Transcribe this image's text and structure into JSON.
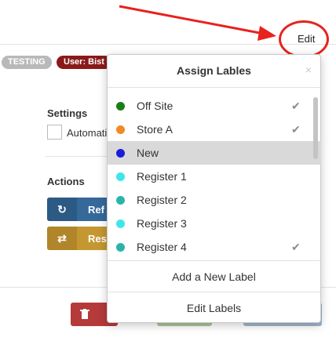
{
  "background": {
    "tags": {
      "testing": "TESTING",
      "user": "User: Bist"
    },
    "settings": {
      "heading": "Settings",
      "checkbox_label": "Automati"
    },
    "actions": {
      "heading": "Actions",
      "buttons": [
        {
          "label": "Ref",
          "icon": "refresh-icon",
          "color": "#34699a"
        },
        {
          "label": "Res",
          "icon": "retweet-icon",
          "color": "#c59730"
        }
      ]
    }
  },
  "annotation": {
    "edit_link": "Edit",
    "circle_color": "#e8221c"
  },
  "popover": {
    "title": "Assign Lables",
    "close_glyph": "×",
    "labels": [
      {
        "name": "Off Site",
        "color": "#1a7d1a",
        "checked": true
      },
      {
        "name": "Store A",
        "color": "#f08a24",
        "checked": true
      },
      {
        "name": "New",
        "color": "#1b1bd9",
        "checked": false,
        "selected": true
      },
      {
        "name": "Register 1",
        "color": "#3fe6e8",
        "checked": false
      },
      {
        "name": "Register 2",
        "color": "#29b3ad",
        "checked": false
      },
      {
        "name": "Register 3",
        "color": "#3fe6e8",
        "checked": false
      },
      {
        "name": "Register 4",
        "color": "#29b3ad",
        "checked": true
      }
    ],
    "add_label": "Add a New Label",
    "edit_labels": "Edit Labels"
  }
}
